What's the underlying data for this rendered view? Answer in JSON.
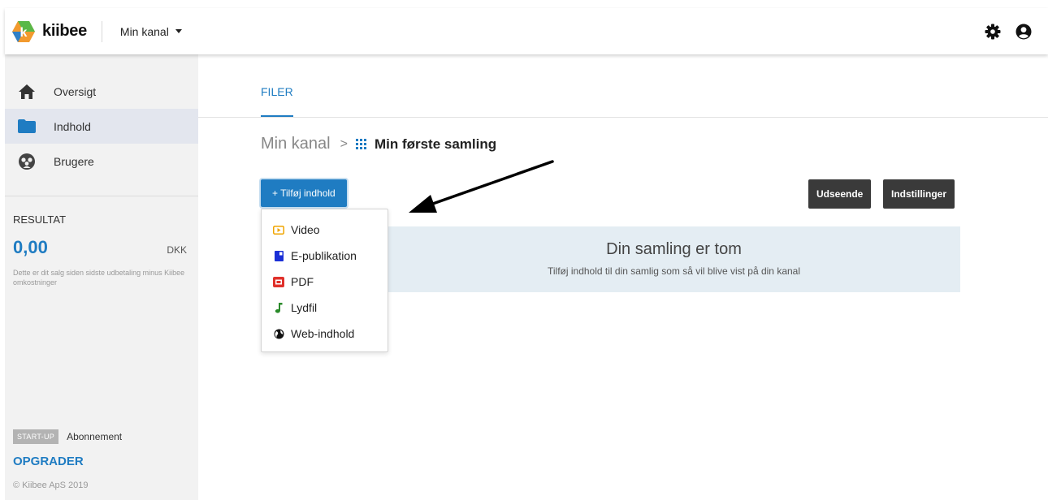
{
  "header": {
    "logo_text": "kiibee",
    "channel_label": "Min kanal",
    "icons": [
      "gear-icon",
      "user-circle-icon"
    ]
  },
  "sidebar": {
    "items": [
      {
        "label": "Oversigt",
        "icon": "home-icon"
      },
      {
        "label": "Indhold",
        "icon": "folder-icon",
        "active": true
      },
      {
        "label": "Brugere",
        "icon": "users-icon"
      }
    ],
    "result_title": "RESULTAT",
    "result_amount": "0,00",
    "result_currency": "DKK",
    "result_note": "Dette er dit salg siden sidste udbetaling minus Kiibee omkostninger",
    "subscription_badge": "START-UP",
    "subscription_label": "Abonnement",
    "upgrade_label": "OPGRADER",
    "copyright": "© Kiibee ApS 2019"
  },
  "main": {
    "tab_label": "FILER",
    "breadcrumb": {
      "root": "Min kanal",
      "separator": ">",
      "current": "Min første samling"
    },
    "add_button_label": "+ Tilføj indhold",
    "appearance_button_label": "Udseende",
    "settings_button_label": "Indstillinger",
    "empty_title": "Din samling er tom",
    "empty_subtitle": "Tilføj indhold til din samlig som så vil blive vist på din kanal",
    "dropdown_items": [
      {
        "label": "Video",
        "icon": "video-icon",
        "color": "#f0a500"
      },
      {
        "label": "E-publikation",
        "icon": "book-icon",
        "color": "#1a2fd6"
      },
      {
        "label": "PDF",
        "icon": "pdf-icon",
        "color": "#e0312b"
      },
      {
        "label": "Lydfil",
        "icon": "music-note-icon",
        "color": "#2a8a2a"
      },
      {
        "label": "Web-indhold",
        "icon": "globe-icon",
        "color": "#111111"
      }
    ]
  },
  "colors": {
    "accent": "#1f7cc2",
    "sidebar_bg": "#f2f2f2",
    "active_item_bg": "#e3e6ee",
    "dark_button": "#3a3a3a",
    "empty_box_bg": "#e4edf3"
  }
}
